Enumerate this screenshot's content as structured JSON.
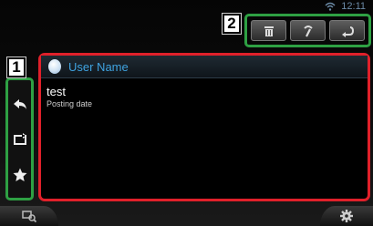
{
  "status": {
    "time": "12:11"
  },
  "callouts": {
    "one": "1",
    "two": "2"
  },
  "post": {
    "user_name": "User Name",
    "text": "test",
    "date": "Posting date"
  },
  "icons": {
    "toolbar": [
      "trash-icon",
      "retweet-pen-icon",
      "back-icon"
    ],
    "sidebar": [
      "reply-icon",
      "retweet-icon",
      "favorite-star-icon"
    ],
    "bottom": [
      "display-search-icon",
      "settings-gear-icon"
    ]
  },
  "colors": {
    "callout_frame_green": "#2ea043",
    "content_frame_red": "#e0202a",
    "user_name_blue": "#3fa3e0"
  }
}
